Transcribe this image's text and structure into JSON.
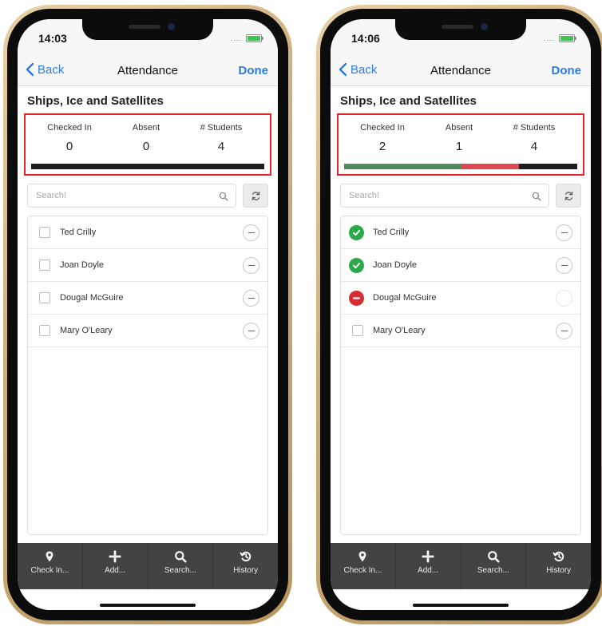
{
  "screens": [
    {
      "status_time": "14:03",
      "nav": {
        "back_label": "Back",
        "title": "Attendance",
        "done_label": "Done"
      },
      "course_title": "Ships, Ice and Satellites",
      "stats": {
        "checked_in_label": "Checked In",
        "checked_in_value": "0",
        "absent_label": "Absent",
        "absent_value": "0",
        "students_label": "# Students",
        "students_value": "4"
      },
      "progress": {
        "present_fraction": 0,
        "absent_fraction": 0,
        "unmarked_fraction": 1
      },
      "search": {
        "placeholder": "Search!"
      },
      "students": [
        {
          "name": "Ted Crilly",
          "status": "unmarked"
        },
        {
          "name": "Joan Doyle",
          "status": "unmarked"
        },
        {
          "name": "Dougal McGuire",
          "status": "unmarked"
        },
        {
          "name": "Mary O'Leary",
          "status": "unmarked"
        }
      ],
      "tabs": [
        {
          "label": "Check In...",
          "icon": "location-pin-icon"
        },
        {
          "label": "Add...",
          "icon": "plus-icon"
        },
        {
          "label": "Search...",
          "icon": "search-icon"
        },
        {
          "label": "History",
          "icon": "history-icon"
        }
      ]
    },
    {
      "status_time": "14:06",
      "nav": {
        "back_label": "Back",
        "title": "Attendance",
        "done_label": "Done"
      },
      "course_title": "Ships, Ice and Satellites",
      "stats": {
        "checked_in_label": "Checked In",
        "checked_in_value": "2",
        "absent_label": "Absent",
        "absent_value": "1",
        "students_label": "# Students",
        "students_value": "4"
      },
      "progress": {
        "present_fraction": 0.5,
        "absent_fraction": 0.25,
        "unmarked_fraction": 0.25
      },
      "search": {
        "placeholder": "Search!"
      },
      "students": [
        {
          "name": "Ted Crilly",
          "status": "present"
        },
        {
          "name": "Joan Doyle",
          "status": "present"
        },
        {
          "name": "Dougal McGuire",
          "status": "absent"
        },
        {
          "name": "Mary O'Leary",
          "status": "unmarked"
        }
      ],
      "tabs": [
        {
          "label": "Check In...",
          "icon": "location-pin-icon"
        },
        {
          "label": "Add...",
          "icon": "plus-icon"
        },
        {
          "label": "Search...",
          "icon": "search-icon"
        },
        {
          "label": "History",
          "icon": "history-icon"
        }
      ]
    }
  ],
  "colors": {
    "accent": "#2e7be4",
    "highlight_border": "#e0262c",
    "present": "#4f8a5c",
    "present_icon": "#2aa84a",
    "absent": "#e04650",
    "absent_icon": "#d72d35",
    "unmarked": "#1b1b22",
    "tabbar": "#434343"
  }
}
